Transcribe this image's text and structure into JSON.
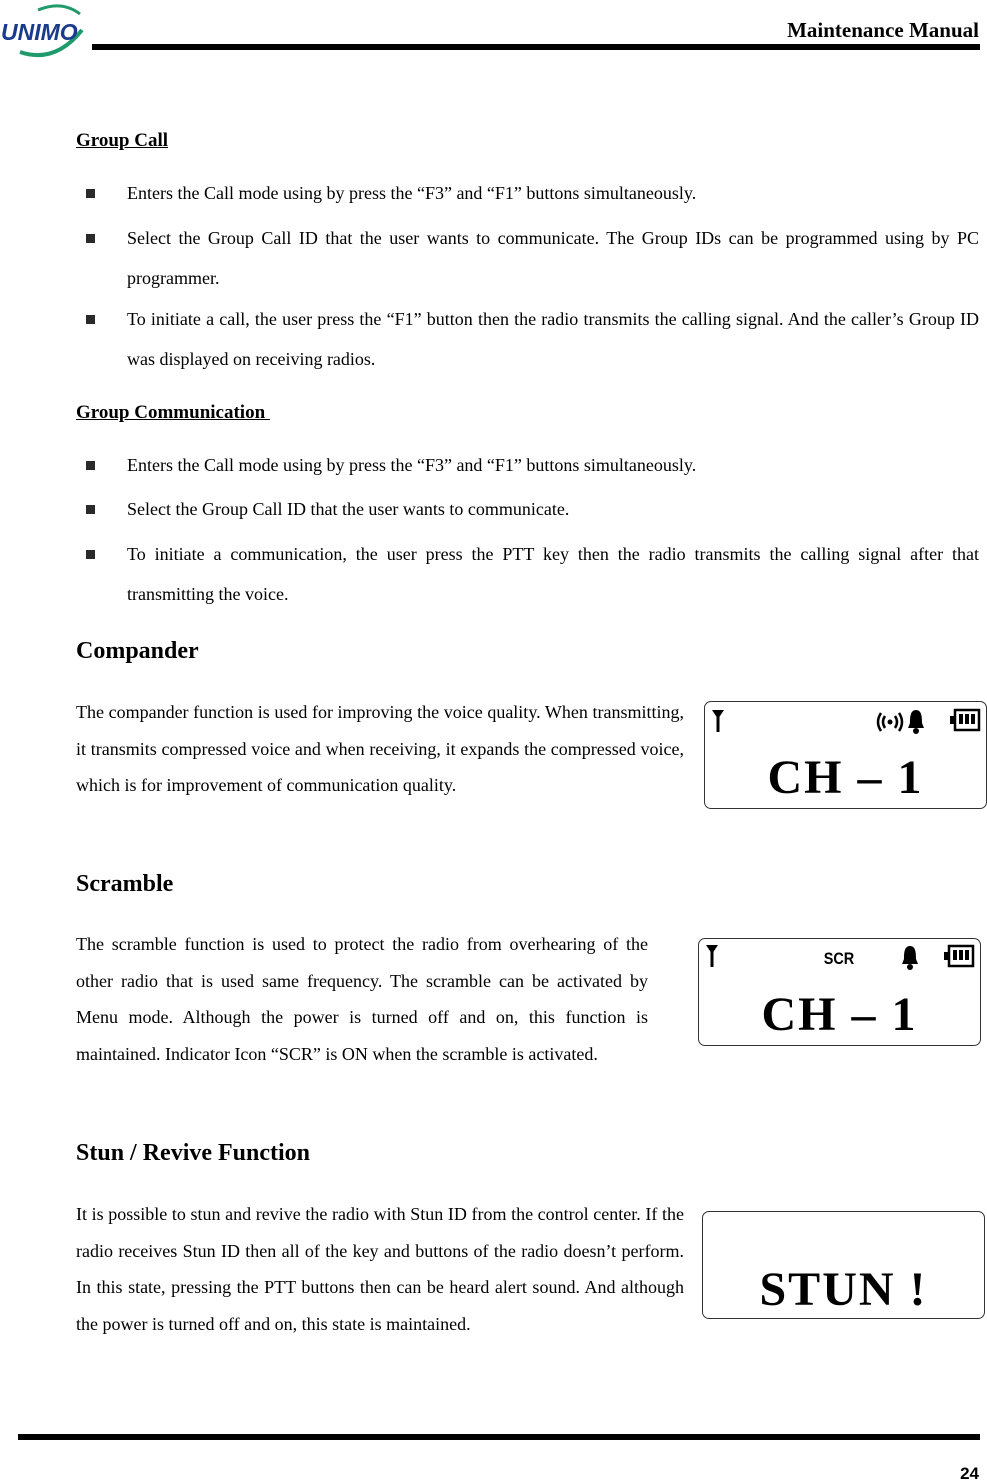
{
  "header": {
    "logo_text": "UNIMO",
    "title": "Maintenance Manual",
    "colors": {
      "logo_blue": "#1a3a8c",
      "logo_green": "#1f9a6a"
    }
  },
  "sections": {
    "group_call": {
      "heading": "Group Call",
      "bullets": [
        "Enters the Call mode using by press the “F3” and “F1” buttons simultaneously.",
        "Select the Group Call ID that the user wants to communicate. The Group IDs can be programmed using by PC programmer.",
        "To initiate a call, the user press the “F1” button then the radio transmits the calling signal. And the caller’s Group ID was displayed on receiving radios."
      ]
    },
    "group_communication": {
      "heading": "Group Communication ",
      "bullets": [
        "Enters the Call mode using by press the “F3” and “F1” buttons simultaneously.",
        "Select the Group Call ID that the user wants to communicate.",
        "To initiate a communication, the user press the PTT key then the radio transmits the calling signal after that transmitting the voice."
      ]
    },
    "compander": {
      "heading": "Compander",
      "paragraph": "The compander function is used for improving the voice quality. When transmitting, it transmits compressed voice and when receiving, it expands the compressed voice, which is for improvement of communication quality.",
      "display": {
        "main_text": "CH – 1",
        "icons": [
          "antenna-icon",
          "compander-signal-icon",
          "bell-icon",
          "battery-icon"
        ]
      }
    },
    "scramble": {
      "heading": "Scramble",
      "paragraph": "The scramble function is used to protect the radio from overhearing of the other radio that is used same frequency. The scramble can be activated by Menu mode. Although the power is turned off and on, this function is maintained. Indicator Icon “SCR” is ON when the scramble is activated.",
      "display": {
        "indicator": "SCR",
        "main_text": "CH – 1",
        "icons": [
          "antenna-icon",
          "bell-icon",
          "battery-icon"
        ]
      }
    },
    "stun_revive": {
      "heading": "Stun / Revive Function",
      "paragraph": "It is possible to stun and revive the radio with Stun ID from the control center. If the radio receives Stun ID then all of the key and buttons of the radio doesn’t perform. In this state, pressing the PTT buttons then can be heard alert sound. And although the power is turned off and on, this state is maintained.",
      "display": {
        "main_text": "STUN !"
      }
    }
  },
  "footer": {
    "page_number": "24"
  }
}
